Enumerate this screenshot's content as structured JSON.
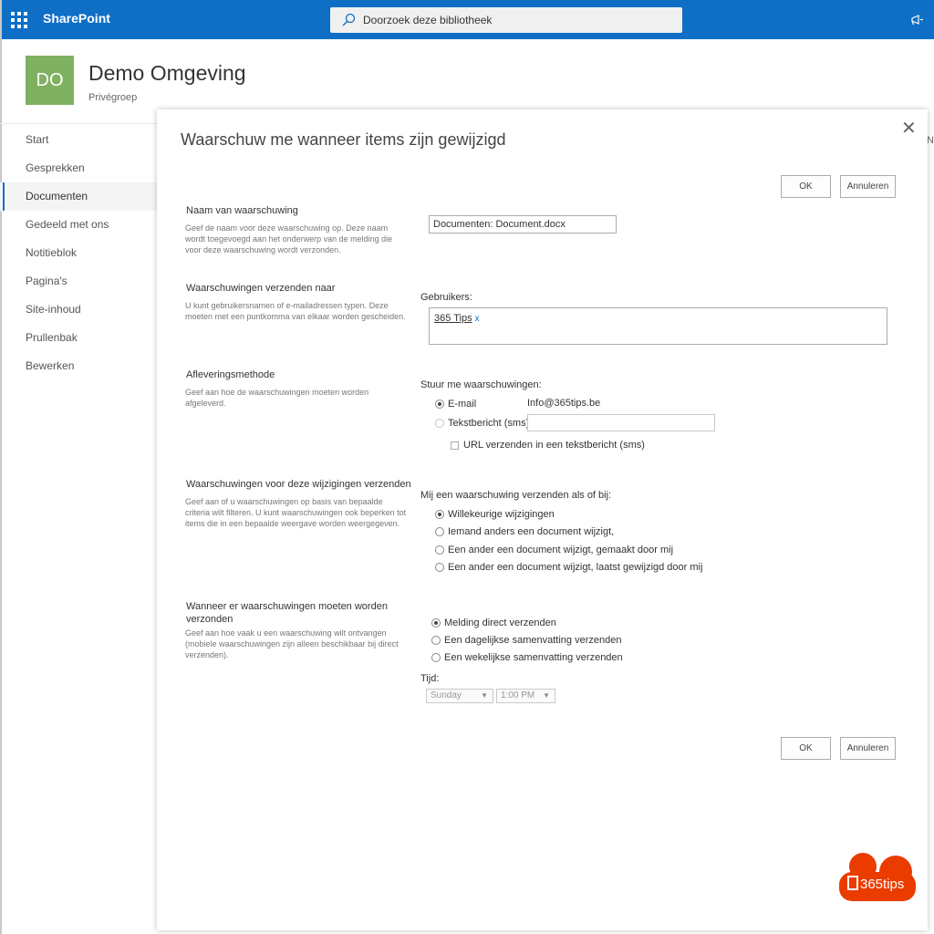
{
  "suitebar": {
    "brand": "SharePoint",
    "search_placeholder": "Doorzoek deze bibliotheek",
    "brand_color": "#0f6fc6"
  },
  "site": {
    "logo_initials": "DO",
    "title": "Demo Omgeving",
    "subtitle": "Privégroep",
    "logo_color": "#7fb161",
    "cut_text": "Ne"
  },
  "leftnav": {
    "items": [
      {
        "label": "Start"
      },
      {
        "label": "Gesprekken"
      },
      {
        "label": "Documenten"
      },
      {
        "label": "Gedeeld met ons"
      },
      {
        "label": "Notitieblok"
      },
      {
        "label": "Pagina's"
      },
      {
        "label": "Site-inhoud"
      },
      {
        "label": "Prullenbak"
      },
      {
        "label": "Bewerken"
      }
    ],
    "active": "Documenten"
  },
  "dialog": {
    "title": "Waarschuw me wanneer items zijn gewijzigd",
    "ok_label": "OK",
    "cancel_label": "Annuleren",
    "sections": {
      "name": {
        "title": "Naam van waarschuwing",
        "desc": "Geef de naam voor deze waarschuwing op. Deze naam wordt toegevoegd aan het onderwerp van de melding die voor deze waarschuwing wordt verzonden.",
        "value": "Documenten: Document.docx"
      },
      "send_to": {
        "title": "Waarschuwingen verzenden naar",
        "desc": "U kunt gebruikersnamen of e-mailadressen typen. Deze moeten met een puntkomma van elkaar worden gescheiden.",
        "users_label": "Gebruikers:",
        "user": "365 Tips",
        "remove": "x"
      },
      "delivery": {
        "title": "Afleveringsmethode",
        "desc": "Geef aan hoe de waarschuwingen moeten worden afgeleverd.",
        "prompt": "Stuur me waarschuwingen:",
        "email_label": "E-mail",
        "email_value": "Info@365tips.be",
        "sms_label": "Tekstbericht (sms)",
        "url_label": "URL verzenden in een tekstbericht (sms)",
        "selected": "E-mail"
      },
      "changes": {
        "title": "Waarschuwingen voor deze wijzigingen verzenden",
        "desc": "Geef aan of u waarschuwingen op basis van bepaalde criteria wilt filteren. U kunt waarschuwingen ook beperken tot items die in een bepaalde weergave worden weergegeven.",
        "prompt": "Mij een waarschuwing verzenden als of bij:",
        "options": [
          "Willekeurige wijzigingen",
          "Iemand anders een document wijzigt,",
          "Een ander een document wijzigt, gemaakt door mij",
          "Een ander een document wijzigt, laatst gewijzigd door mij"
        ],
        "selected": "Willekeurige wijzigingen"
      },
      "when": {
        "title": "Wanneer er waarschuwingen moeten worden verzonden",
        "desc": "Geef aan hoe vaak u een waarschuwing wilt ontvangen (mobiele waarschuwingen zijn alleen beschikbaar bij direct verzenden).",
        "options": [
          "Melding direct verzenden",
          "Een dagelijkse samenvatting verzenden",
          "Een wekelijkse samenvatting verzenden"
        ],
        "selected": "Melding direct verzenden",
        "time_label": "Tijd:",
        "day_value": "Sunday",
        "time_value": "1:00 PM"
      }
    }
  },
  "watermark": {
    "text": "365tips",
    "color": "#eb3c00"
  }
}
